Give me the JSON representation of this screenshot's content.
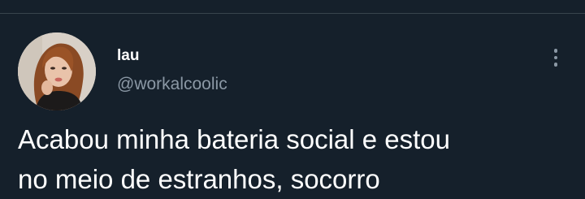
{
  "tweet": {
    "author": {
      "display_name": "lau",
      "handle": "@workalcoolic",
      "avatar_icon": "profile-photo"
    },
    "more_icon": "more-vertical-icon",
    "text": "Acabou minha bateria social e estou\nno meio de estranhos, socorro"
  },
  "colors": {
    "background": "#15202b",
    "divider": "#38444d",
    "primary_text": "#ffffff",
    "secondary_text": "#8b98a5"
  }
}
